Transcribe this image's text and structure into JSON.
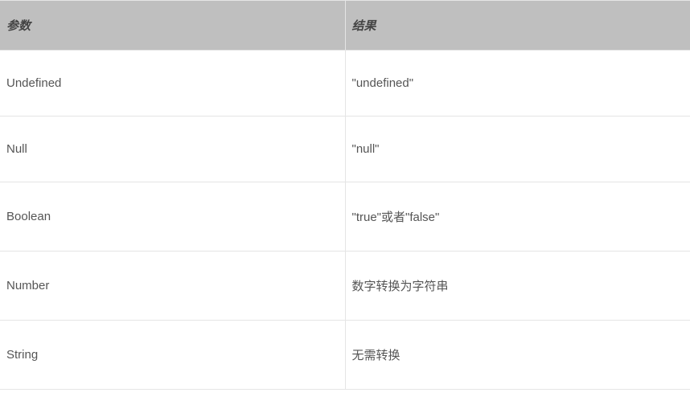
{
  "chart_data": {
    "type": "table",
    "columns": [
      "参数",
      "结果"
    ],
    "rows": [
      [
        "Undefined",
        "\"undefined\""
      ],
      [
        "Null",
        "\"null\""
      ],
      [
        "Boolean",
        "\"true\"或者\"false\""
      ],
      [
        "Number",
        "数字转换为字符串"
      ],
      [
        "String",
        "无需转换"
      ]
    ]
  },
  "headers": {
    "col_0": "参数",
    "col_1": "结果"
  },
  "rows": [
    {
      "param": "Undefined",
      "result": "\"undefined\""
    },
    {
      "param": "Null",
      "result": "\"null\""
    },
    {
      "param": "Boolean",
      "result": "\"true\"或者\"false\""
    },
    {
      "param": "Number",
      "result": "数字转换为字符串"
    },
    {
      "param": "String",
      "result": "无需转换"
    }
  ]
}
